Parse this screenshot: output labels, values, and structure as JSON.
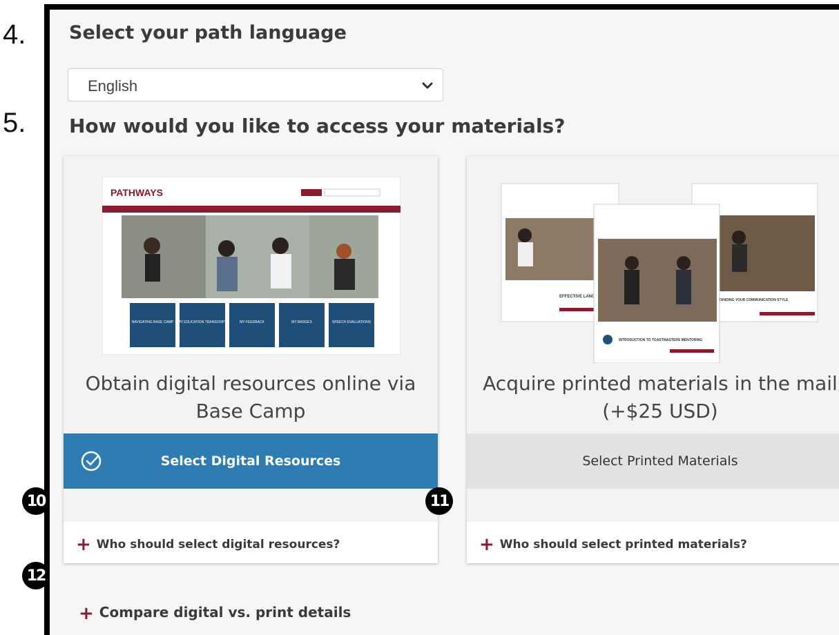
{
  "steps": {
    "language": "4.",
    "access": "5."
  },
  "language_section": {
    "heading": "Select your path language",
    "selected": "English"
  },
  "access_section": {
    "heading": "How would you like to access your materials?"
  },
  "digital_card": {
    "title": "Obtain digital resources online via Base Camp",
    "button_label": "Select Digital Resources",
    "selected": true,
    "faq": "Who should select digital resources?",
    "badge": "10",
    "image": {
      "brand": "PATHWAYS",
      "tiles": [
        "NAVIGATING BASE CAMP",
        "MY EDUCATION TRANSCRIPT",
        "MY FEEDBACK",
        "MY BADGES",
        "SPEECH EVALUATIONS"
      ]
    }
  },
  "print_card": {
    "title": "Acquire printed materials in the mail (+$25 USD)",
    "button_label": "Select Printed Materials",
    "selected": false,
    "faq": "Who should select printed materials?",
    "badge": "11",
    "image": {
      "books": [
        "EFFECTIVE LANG",
        "INTRODUCTION TO TOASTMASTERS MENTORING",
        "UNDERSTANDING YOUR COMMUNICATION STYLE"
      ]
    }
  },
  "compare": {
    "label": "Compare digital vs. print details",
    "badge": "12"
  },
  "colors": {
    "accent_blue": "#2e7cb1",
    "brand_maroon": "#8a1a2e",
    "tile_blue": "#1e4f78"
  }
}
